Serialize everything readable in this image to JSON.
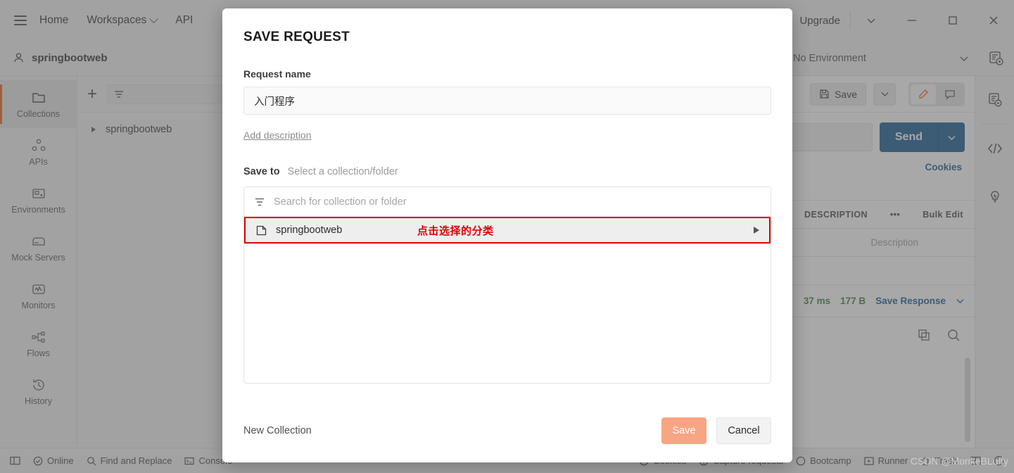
{
  "app": {
    "topbar": {
      "menu_icon": "hamburger-icon",
      "nav": [
        {
          "label": "Home",
          "caret": false
        },
        {
          "label": "Workspaces",
          "caret": true
        },
        {
          "label": "API",
          "caret": true
        }
      ],
      "upgrade_label": "Upgrade",
      "window_controls": [
        "minimize-icon",
        "maximize-icon",
        "close-icon"
      ]
    },
    "workspace": {
      "name": "springbootweb",
      "environment_selected": "No Environment"
    },
    "rail": [
      {
        "label": "Collections",
        "icon": "collections-icon",
        "active": true
      },
      {
        "label": "APIs",
        "icon": "apis-icon",
        "active": false
      },
      {
        "label": "Environments",
        "icon": "environments-icon",
        "active": false
      },
      {
        "label": "Mock Servers",
        "icon": "mock-servers-icon",
        "active": false
      },
      {
        "label": "Monitors",
        "icon": "monitors-icon",
        "active": false
      },
      {
        "label": "Flows",
        "icon": "flows-icon",
        "active": false
      },
      {
        "label": "History",
        "icon": "history-icon",
        "active": false
      }
    ],
    "collections_panel": {
      "add_label": "+",
      "filter_icon": "filter-icon",
      "tree": [
        {
          "label": "springbootweb"
        }
      ]
    },
    "request": {
      "save_label": "Save",
      "send_label": "Send",
      "cookies_label": "Cookies",
      "params_header": [
        "DESCRIPTION"
      ],
      "bulk_edit_label": "Bulk Edit",
      "description_placeholder": "Description",
      "response_time": "37 ms",
      "response_size": "177 B",
      "save_response_label": "Save Response"
    },
    "statusbar": {
      "left": [
        {
          "label": "Online",
          "icon": "online-check-icon"
        },
        {
          "label": "Find and Replace",
          "icon": "search-icon"
        },
        {
          "label": "Console",
          "icon": "console-icon"
        }
      ],
      "right": [
        {
          "label": "Cookies",
          "icon": "cookies-icon"
        },
        {
          "label": "Capture requests",
          "icon": "capture-icon"
        },
        {
          "label": "Bootcamp",
          "icon": "bootcamp-icon"
        },
        {
          "label": "Runner",
          "icon": "runner-icon"
        },
        {
          "label": "Trash",
          "icon": "trash-icon"
        },
        {
          "label": "",
          "icon": "layout-icon"
        },
        {
          "label": "",
          "icon": "help-icon"
        }
      ]
    }
  },
  "modal": {
    "title": "SAVE REQUEST",
    "request_name_label": "Request name",
    "request_name_value": "入门程序",
    "add_description_label": "Add description",
    "save_to_label": "Save to",
    "save_to_value": "Select a collection/folder",
    "picker_search_placeholder": "Search for collection or folder",
    "picker_items": [
      {
        "name": "springbootweb",
        "icon": "collection-icon",
        "annotation": "点击选择的分类",
        "highlighted": true,
        "expand_icon": "triangle-right-icon"
      }
    ],
    "new_collection_label": "New Collection",
    "save_button": "Save",
    "cancel_button": "Cancel",
    "colors": {
      "annotation_red": "#e00000",
      "save_button_bg": "#f8a583",
      "accent_orange": "#e8610e",
      "send_blue": "#11548f"
    }
  },
  "watermark": "CSDN @MonkeBLuffy"
}
